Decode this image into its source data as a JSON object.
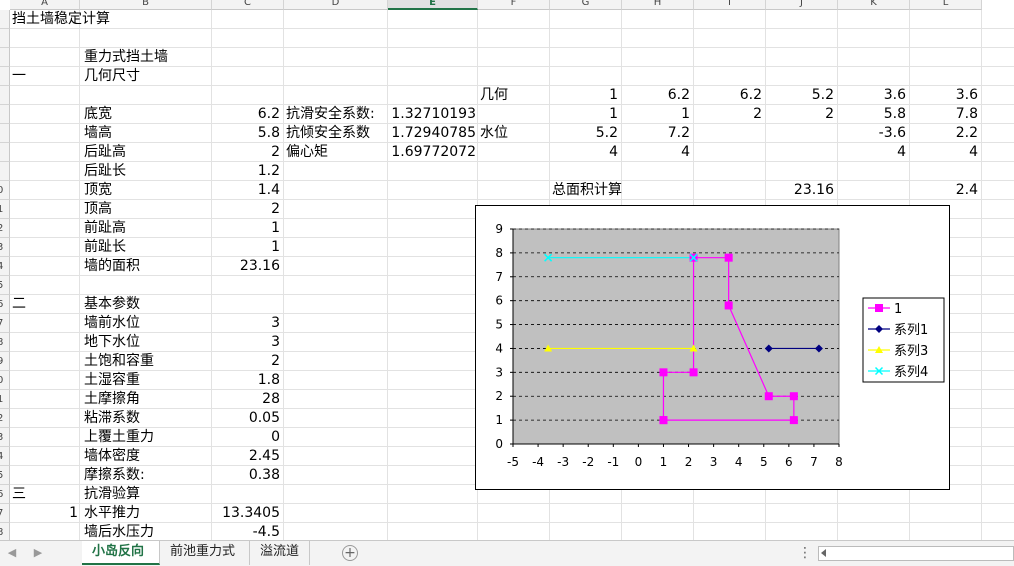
{
  "sheet": {
    "column_headers": [
      "A",
      "B",
      "C",
      "D",
      "E",
      "F",
      "G",
      "H",
      "I",
      "J",
      "K",
      "L"
    ],
    "selected_column": "E",
    "row_numbers": [
      "",
      "",
      "",
      "",
      "",
      "",
      "",
      "",
      "",
      "0",
      "1",
      "2",
      "3",
      "4",
      "5",
      "6",
      "7",
      "8",
      "9",
      "0",
      "1",
      "2",
      "3",
      "4",
      "5",
      "6",
      "7",
      "8"
    ],
    "cells": {
      "title": "挡土墙稳定计算",
      "wall_type": "重力式挡土墙",
      "sec1_num": "一",
      "sec1_label": "几何尺寸",
      "bottom_width_label": "底宽",
      "bottom_width_value": "6.2",
      "wall_height_label": "墙高",
      "wall_height_value": "5.8",
      "heel_height_label": "后趾高",
      "heel_height_value": "2",
      "heel_length_label": "后趾长",
      "heel_length_value": "1.2",
      "top_width_label": "顶宽",
      "top_width_value": "1.4",
      "top_height_label": "顶高",
      "top_height_value": "2",
      "toe_height_label": "前趾高",
      "toe_height_value": "1",
      "toe_length_label": "前趾长",
      "toe_length_value": "1",
      "wall_area_label": "墙的面积",
      "wall_area_value": "23.16",
      "sec2_num": "二",
      "sec2_label": "基本参数",
      "front_water_label": "墙前水位",
      "front_water_value": "3",
      "ground_water_label": "地下水位",
      "ground_water_value": "3",
      "sat_weight_label": "土饱和容重",
      "sat_weight_value": "2",
      "wet_weight_label": "土湿容重",
      "wet_weight_value": "1.8",
      "friction_angle_label": "土摩擦角",
      "friction_angle_value": "28",
      "cohesion_label": "粘滞系数",
      "cohesion_value": "0.05",
      "overburden_label": "上覆土重力",
      "overburden_value": "0",
      "wall_density_label": "墙体密度",
      "wall_density_value": "2.45",
      "friction_coef_label": "摩擦系数:",
      "friction_coef_value": "0.38",
      "sec3_num": "三",
      "sec3_label": "抗滑验算",
      "item1_num": "1",
      "horizontal_thrust_label": "水平推力",
      "horizontal_thrust_value": "13.3405",
      "back_water_label": "墙后水压力",
      "back_water_value": "-4.5",
      "sliding_factor_label": "抗滑安全系数:",
      "sliding_factor_value": "1.32710193",
      "overturn_factor_label": "抗倾安全系数",
      "overturn_factor_value": "1.72940785",
      "eccentric_label": "偏心矩",
      "eccentric_value": "1.69772072",
      "geometry_label": "几何",
      "geo_x": [
        "1",
        "6.2",
        "6.2",
        "5.2",
        "3.6",
        "3.6"
      ],
      "geo_y": [
        "1",
        "1",
        "2",
        "2",
        "5.8",
        "7.8"
      ],
      "water_label": "水位",
      "water_row1": [
        "5.2",
        "7.2",
        "",
        "",
        "-3.6",
        "2.2"
      ],
      "water_row2": [
        "4",
        "4",
        "",
        "",
        "4",
        "4"
      ],
      "total_area_label": "总面积计算",
      "total_area_value": "23.16",
      "total_area_extra": "2.4"
    }
  },
  "chart_data": {
    "type": "scatter",
    "xlim": [
      -5,
      8
    ],
    "ylim": [
      0,
      9
    ],
    "x_ticks": [
      "-5",
      "-4",
      "-3",
      "-2",
      "-1",
      "0",
      "1",
      "2",
      "3",
      "4",
      "5",
      "6",
      "7",
      "8"
    ],
    "y_ticks": [
      "0",
      "1",
      "2",
      "3",
      "4",
      "5",
      "6",
      "7",
      "8",
      "9"
    ],
    "grid": "horizontal-dashed",
    "plot_background": "#c0c0c0",
    "legend_position": "right",
    "series": [
      {
        "name": "1",
        "color": "#ff00ff",
        "marker": "square",
        "x": [
          1,
          6.2,
          6.2,
          5.2,
          3.6,
          3.6,
          2.2,
          2.2,
          1,
          1
        ],
        "y": [
          1,
          1,
          2,
          2,
          5.8,
          7.8,
          7.8,
          3,
          3,
          1
        ]
      },
      {
        "name": "系列1",
        "color": "#000080",
        "marker": "diamond",
        "x": [
          5.2,
          7.2
        ],
        "y": [
          4,
          4
        ]
      },
      {
        "name": "系列3",
        "color": "#ffff00",
        "marker": "triangle",
        "x": [
          -3.6,
          2.2
        ],
        "y": [
          4,
          4
        ]
      },
      {
        "name": "系列4",
        "color": "#00ffff",
        "marker": "x",
        "x": [
          -3.6,
          2.2
        ],
        "y": [
          7.8,
          7.8
        ]
      }
    ]
  },
  "tabs": {
    "items": [
      "小岛反向",
      "前池重力式",
      "溢流道"
    ],
    "active_index": 0
  }
}
